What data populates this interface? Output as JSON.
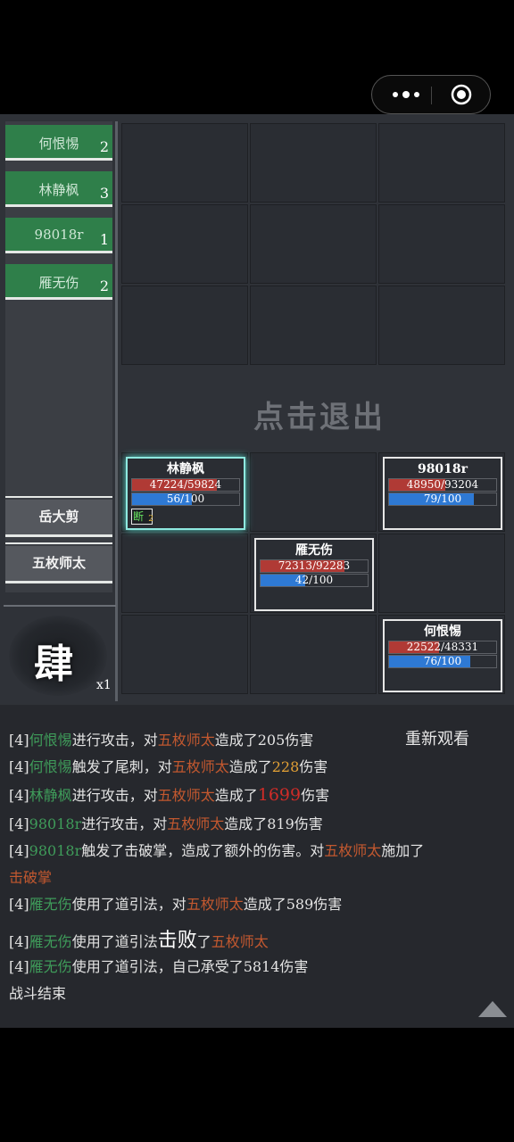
{
  "allies": [
    {
      "name": "何恨惕",
      "count": "2"
    },
    {
      "name": "林静枫",
      "count": "3"
    },
    {
      "name": "98018r",
      "count": "1"
    },
    {
      "name": "雁无伤",
      "count": "2"
    }
  ],
  "enemies": [
    {
      "name": "岳大剪"
    },
    {
      "name": "五枚师太"
    }
  ],
  "round": {
    "char": "肆",
    "multiplier": "x1"
  },
  "exit_text": "点击退出",
  "replay_label": "重新观看",
  "units": [
    {
      "name": "林静枫",
      "hp": "47224/59824",
      "hp_frac": 0.789,
      "mp": "56/100",
      "mp_frac": 0.56,
      "active": true,
      "buff": {
        "char": "断",
        "stack": "2"
      }
    },
    {
      "name": "98018r",
      "hp": "48950/93204",
      "hp_frac": 0.525,
      "mp": "79/100",
      "mp_frac": 0.79,
      "active": false
    },
    {
      "name": "雁无伤",
      "hp": "72313/92283",
      "hp_frac": 0.784,
      "mp": "42/100",
      "mp_frac": 0.42,
      "active": false
    },
    {
      "name": "何恨惕",
      "hp": "22522/48331",
      "hp_frac": 0.466,
      "mp": "76/100",
      "mp_frac": 0.76,
      "active": false
    }
  ],
  "log": {
    "l1": {
      "tag": "[4]",
      "actor": "何恨惕",
      "a": "进行攻击，对",
      "target": "五枚师太",
      "b": "造成了205伤害"
    },
    "l2": {
      "tag": "[4]",
      "actor": "何恨惕",
      "a": "触发了尾刺，对",
      "target": "五枚师太",
      "b": "造成了",
      "num": "228",
      "c": "伤害"
    },
    "l3": {
      "tag": "[4]",
      "actor": "林静枫",
      "a": "进行攻击，对",
      "target": "五枚师太",
      "b": "造成了",
      "num": "1699",
      "c": "伤害"
    },
    "l4": {
      "tag": "[4]",
      "actor": "98018r",
      "a": "进行攻击，对",
      "target": "五枚师太",
      "b": "造成了819伤害"
    },
    "l5": {
      "tag": "[4]",
      "actor": "98018r",
      "a": "触发了击破掌，造成了额外的伤害。对",
      "target": "五枚师太",
      "b": "施加了",
      "skill": "击破掌"
    },
    "l6": {
      "tag": "[4]",
      "actor": "雁无伤",
      "a": "使用了道引法，对",
      "target": "五枚师太",
      "b": "造成了589伤害"
    },
    "l7": {
      "tag": "[4]",
      "actor": "雁无伤",
      "a": "使用了道引法",
      "big": "击败",
      "b": "了",
      "target": "五枚师太"
    },
    "l8": {
      "tag": "[4]",
      "actor": "雁无伤",
      "a": "使用了道引法，自己承受了5814伤害"
    },
    "end": "战斗结束"
  },
  "colors": {
    "ally": "#2f7f4a",
    "hp": "#b03a35",
    "mp": "#2e79d4",
    "actor": "#3f9c5a",
    "target": "#c2582f",
    "active_border": "#8fe9e0"
  }
}
